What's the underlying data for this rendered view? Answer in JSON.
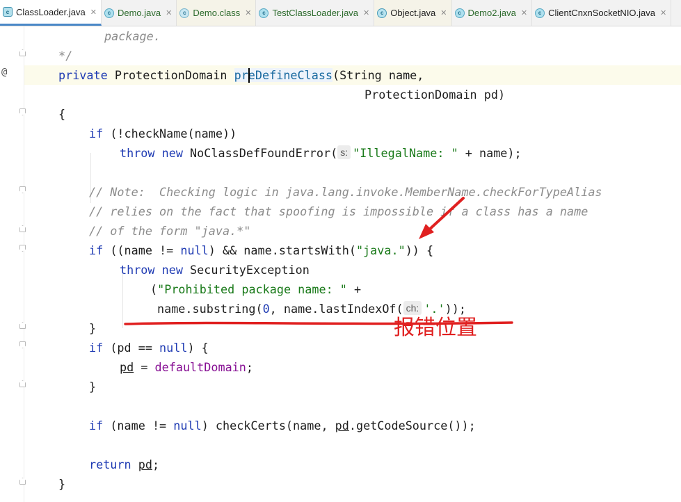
{
  "tabs": [
    {
      "label": "ClassLoader.java",
      "icon": "java-class-icon",
      "active": true
    },
    {
      "label": "Demo.java",
      "icon": "java-class-icon"
    },
    {
      "label": "Demo.class",
      "icon": "class-file-icon"
    },
    {
      "label": "TestClassLoader.java",
      "icon": "java-class-icon"
    },
    {
      "label": "Object.java",
      "icon": "java-class-icon"
    },
    {
      "label": "Demo2.java",
      "icon": "java-class-icon"
    },
    {
      "label": "ClientCnxnSocketNIO.java",
      "icon": "java-class-icon"
    }
  ],
  "gutter": {
    "override_marker": "@"
  },
  "code": {
    "l1": "package.",
    "l2": "*/",
    "l3_kw": "private",
    "l3_type": " ProtectionDomain ",
    "l3_meth": "preDefineClass",
    "l3_rest": "(String name,",
    "l4": "ProtectionDomain pd)",
    "l5": "{",
    "l6_kw": "if",
    "l6_rest": " (!checkName(name))",
    "l7_kw1": "throw",
    "l7_kw2": "new",
    "l7_a": " NoClassDefFoundError(",
    "l7_hint": "s:",
    "l7_str": "\"IllegalName: \"",
    "l7_b": " + name);",
    "l9": "// Note:  Checking logic in java.lang.invoke.MemberName.checkForTypeAlias",
    "l10": "// relies on the fact that spoofing is impossible if a class has a name",
    "l11": "// of the form \"java.*\"",
    "l12_kw": "if",
    "l12_a": " ((name != ",
    "l12_null": "null",
    "l12_b": ") && name.startsWith(",
    "l12_str": "\"java.\"",
    "l12_c": ")) {",
    "l13_kw1": "throw",
    "l13_kw2": "new",
    "l13_a": " SecurityException",
    "l14_a": "(",
    "l14_str": "\"Prohibited package name: \"",
    "l14_b": " +",
    "l15_a": "name.substring(",
    "l15_num": "0",
    "l15_b": ", name.lastIndexOf(",
    "l15_hint": "ch:",
    "l15_str": "'.'",
    "l15_c": "));",
    "l16": "}",
    "l17_kw": "if",
    "l17_a": " (pd == ",
    "l17_null": "null",
    "l17_b": ") {",
    "l18_pd": "pd",
    "l18_a": " = ",
    "l18_field": "defaultDomain",
    "l18_b": ";",
    "l19": "}",
    "l21_kw": "if",
    "l21_a": " (name != ",
    "l21_null": "null",
    "l21_b": ") checkCerts(name, ",
    "l21_pd": "pd",
    "l21_c": ".getCodeSource());",
    "l23_kw": "return",
    "l23_pd": "pd",
    "l23_b": ";",
    "l24": "}"
  },
  "annotation": {
    "label": "报错位置",
    "color": "#e02020"
  }
}
